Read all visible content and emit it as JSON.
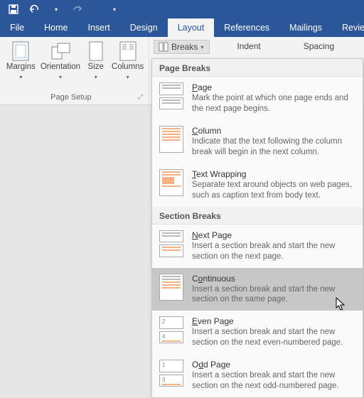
{
  "qat": {
    "save": "save-icon",
    "undo": "undo-icon",
    "redo": "redo-icon",
    "customize": "customize-icon"
  },
  "tabs": {
    "file": "File",
    "home": "Home",
    "insert": "Insert",
    "design": "Design",
    "layout": "Layout",
    "references": "References",
    "mailings": "Mailings",
    "review": "Revie"
  },
  "pagesetup": {
    "margins": "Margins",
    "orientation": "Orientation",
    "size": "Size",
    "columns": "Columns",
    "group_label": "Page Setup"
  },
  "breaks_button": "Breaks",
  "paragraph_labels": {
    "indent": "Indent",
    "spacing": "Spacing"
  },
  "dropdown": {
    "section_page_breaks": "Page Breaks",
    "page": {
      "title_pre": "",
      "title_u": "P",
      "title_post": "age",
      "desc": "Mark the point at which one page ends and the next page begins."
    },
    "column": {
      "title_pre": "",
      "title_u": "C",
      "title_post": "olumn",
      "desc": "Indicate that the text following the column break will begin in the next column."
    },
    "textwrap": {
      "title_pre": "",
      "title_u": "T",
      "title_post": "ext Wrapping",
      "desc": "Separate text around objects on web pages, such as caption text from body text."
    },
    "section_section_breaks": "Section Breaks",
    "nextpage": {
      "title_pre": "",
      "title_u": "N",
      "title_post": "ext Page",
      "desc": "Insert a section break and start the new section on the next page."
    },
    "continuous": {
      "title_pre": "C",
      "title_u": "o",
      "title_post": "ntinuous",
      "desc": "Insert a section break and start the new section on the same page."
    },
    "evenpage": {
      "title_pre": "",
      "title_u": "E",
      "title_post": "ven Page",
      "desc": "Insert a section break and start the new section on the next even-numbered page."
    },
    "oddpage": {
      "title_pre": "O",
      "title_u": "d",
      "title_post": "d Page",
      "desc": "Insert a section break and start the new section on the next odd-numbered page."
    }
  }
}
